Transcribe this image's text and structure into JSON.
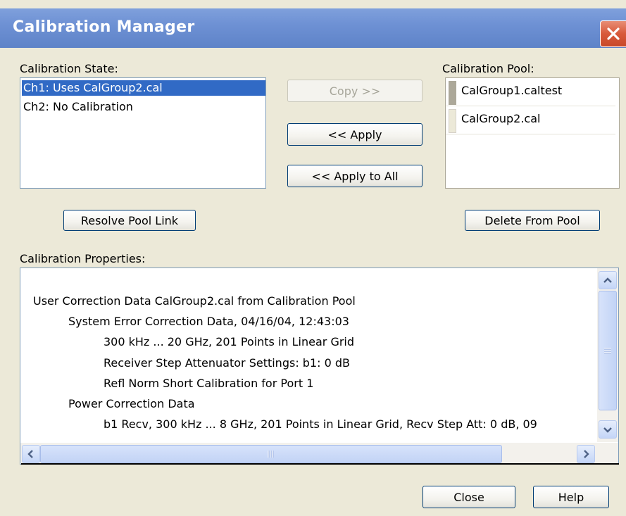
{
  "window": {
    "title": "Calibration Manager",
    "title_bar_color": "#6e91d4"
  },
  "calibration_state": {
    "label": "Calibration State:",
    "items": [
      {
        "text": "Ch1: Uses CalGroup2.cal",
        "selected": true
      },
      {
        "text": "Ch2: No Calibration",
        "selected": false
      }
    ]
  },
  "calibration_pool": {
    "label": "Calibration Pool:",
    "items": [
      {
        "text": "CalGroup1.caltest"
      },
      {
        "text": "CalGroup2.cal"
      }
    ]
  },
  "buttons": {
    "copy": "Copy >>",
    "apply": "<< Apply",
    "apply_all": "<< Apply to All",
    "resolve": "Resolve Pool Link",
    "delete": "Delete From Pool",
    "close": "Close",
    "help": "Help"
  },
  "properties": {
    "label": "Calibration Properties:",
    "lines": [
      {
        "text": "User Correction Data CalGroup2.cal from Calibration Pool",
        "indent": 0
      },
      {
        "text": "System Error Correction Data, 04/16/04, 12:43:03",
        "indent": 1
      },
      {
        "text": "300 kHz ... 20 GHz, 201 Points in Linear Grid",
        "indent": 2
      },
      {
        "text": "Receiver Step Attenuator Settings: b1: 0 dB",
        "indent": 2
      },
      {
        "text": "Refl Norm Short Calibration for Port 1",
        "indent": 2
      },
      {
        "text": "Power Correction Data",
        "indent": 1
      },
      {
        "text": "b1 Recv, 300 kHz ... 8 GHz, 201 Points in Linear Grid, Recv Step Att: 0 dB, 09",
        "indent": 2
      }
    ]
  },
  "colors": {
    "selection": "#316ac5",
    "dialog_bg": "#ece9d8",
    "close_button": "#d8593a"
  }
}
